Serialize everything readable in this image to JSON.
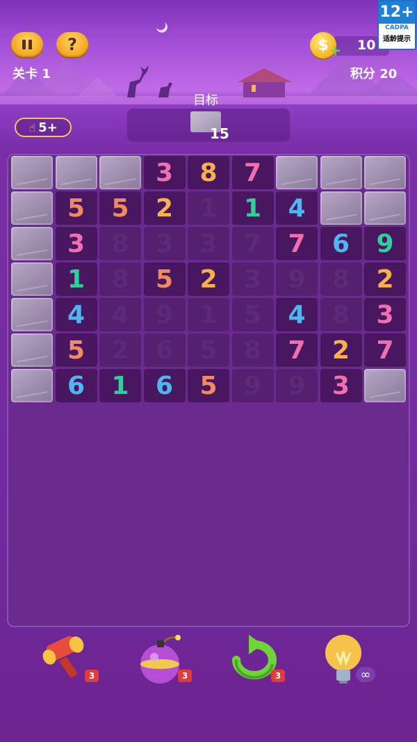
{
  "header": {
    "level_label": "关卡 1",
    "score_label": "积分",
    "score_value": "20",
    "coins": "10",
    "coin_symbol": "$",
    "coin_plus": "+",
    "pause_icon": "pause-icon",
    "help_symbol": "?",
    "age_rating": {
      "rating": "12+",
      "org": "CADPA",
      "note": "适龄提示"
    }
  },
  "target": {
    "label": "目标",
    "count": "15"
  },
  "hint": {
    "label": "5+",
    "icon": "pointing-hand-icon"
  },
  "board": {
    "rows": [
      [
        {
          "t": "stone"
        },
        {
          "t": "stone"
        },
        {
          "t": "stone"
        },
        {
          "t": "num",
          "v": "3",
          "c": "#f06fb0"
        },
        {
          "t": "num",
          "v": "8",
          "c": "#f6b04d"
        },
        {
          "t": "num",
          "v": "7",
          "c": "#f06fb0"
        },
        {
          "t": "stone"
        },
        {
          "t": "stone"
        },
        {
          "t": "stone"
        }
      ],
      [
        {
          "t": "stone"
        },
        {
          "t": "num",
          "v": "5",
          "c": "#f08a60"
        },
        {
          "t": "num",
          "v": "5",
          "c": "#f08a60"
        },
        {
          "t": "num",
          "v": "2",
          "c": "#f6b04d"
        },
        {
          "t": "faded",
          "v": "1"
        },
        {
          "t": "num",
          "v": "1",
          "c": "#2fcf9c"
        },
        {
          "t": "num",
          "v": "4",
          "c": "#4fb7ef"
        },
        {
          "t": "stone"
        },
        {
          "t": "stone"
        }
      ],
      [
        {
          "t": "stone"
        },
        {
          "t": "num",
          "v": "3",
          "c": "#f06fb0"
        },
        {
          "t": "faded",
          "v": "8"
        },
        {
          "t": "faded",
          "v": "3"
        },
        {
          "t": "faded",
          "v": "3"
        },
        {
          "t": "faded",
          "v": "7"
        },
        {
          "t": "num",
          "v": "7",
          "c": "#f06fb0"
        },
        {
          "t": "num",
          "v": "6",
          "c": "#4fb7ef"
        },
        {
          "t": "num",
          "v": "9",
          "c": "#2fcf9c"
        }
      ],
      [
        {
          "t": "stone"
        },
        {
          "t": "num",
          "v": "1",
          "c": "#2fcf9c"
        },
        {
          "t": "faded",
          "v": "8"
        },
        {
          "t": "num",
          "v": "5",
          "c": "#f08a60"
        },
        {
          "t": "num",
          "v": "2",
          "c": "#f6b04d"
        },
        {
          "t": "faded",
          "v": "3"
        },
        {
          "t": "faded",
          "v": "9"
        },
        {
          "t": "faded",
          "v": "8"
        },
        {
          "t": "num",
          "v": "2",
          "c": "#f6b04d"
        }
      ],
      [
        {
          "t": "stone"
        },
        {
          "t": "num",
          "v": "4",
          "c": "#4fb7ef"
        },
        {
          "t": "faded",
          "v": "4"
        },
        {
          "t": "faded",
          "v": "9"
        },
        {
          "t": "faded",
          "v": "1"
        },
        {
          "t": "faded",
          "v": "5"
        },
        {
          "t": "num",
          "v": "4",
          "c": "#4fb7ef"
        },
        {
          "t": "faded",
          "v": "8"
        },
        {
          "t": "num",
          "v": "3",
          "c": "#f06fb0"
        }
      ],
      [
        {
          "t": "stone"
        },
        {
          "t": "num",
          "v": "5",
          "c": "#f08a60"
        },
        {
          "t": "faded",
          "v": "2"
        },
        {
          "t": "faded",
          "v": "6"
        },
        {
          "t": "faded",
          "v": "5"
        },
        {
          "t": "faded",
          "v": "8"
        },
        {
          "t": "num",
          "v": "7",
          "c": "#f06fb0"
        },
        {
          "t": "num",
          "v": "2",
          "c": "#f6b04d"
        },
        {
          "t": "num",
          "v": "7",
          "c": "#f06fb0"
        }
      ],
      [
        {
          "t": "stone"
        },
        {
          "t": "num",
          "v": "6",
          "c": "#4fb7ef"
        },
        {
          "t": "num",
          "v": "1",
          "c": "#2fcf9c"
        },
        {
          "t": "num",
          "v": "6",
          "c": "#4fb7ef"
        },
        {
          "t": "num",
          "v": "5",
          "c": "#f08a60"
        },
        {
          "t": "faded",
          "v": "9"
        },
        {
          "t": "faded",
          "v": "9"
        },
        {
          "t": "num",
          "v": "3",
          "c": "#f06fb0"
        },
        {
          "t": "stone"
        }
      ]
    ]
  },
  "tools": [
    {
      "name": "hammer-tool",
      "icon": "hammer-icon",
      "count": "3"
    },
    {
      "name": "bomb-tool",
      "icon": "bomb-icon",
      "count": "3"
    },
    {
      "name": "refresh-tool",
      "icon": "refresh-icon",
      "count": "3"
    },
    {
      "name": "hint-tool",
      "icon": "lightbulb-icon",
      "count": "∞"
    }
  ],
  "colors": {
    "pink": "#f06fb0",
    "orange": "#f08a60",
    "yellow": "#f6b04d",
    "green": "#2fcf9c",
    "blue": "#4fb7ef",
    "faded": "#5e2a77"
  }
}
